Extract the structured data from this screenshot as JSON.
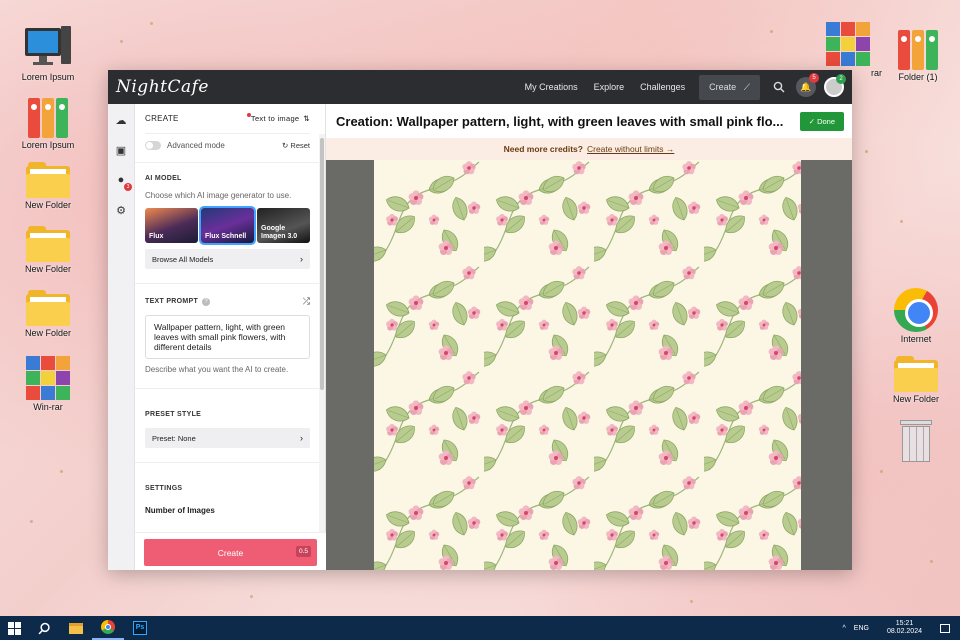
{
  "desktop": {
    "icons": [
      {
        "label": "Lorem Ipsum"
      },
      {
        "label": "Lorem Ipsum"
      },
      {
        "label": "New Folder"
      },
      {
        "label": "New Folder"
      },
      {
        "label": "New Folder"
      },
      {
        "label": "Win-rar"
      },
      {
        "label": "rar"
      },
      {
        "label": "Folder (1)"
      },
      {
        "label": "Internet"
      },
      {
        "label": "New Folder"
      }
    ]
  },
  "app": {
    "logo": "NightCafe",
    "nav": [
      "My Creations",
      "Explore",
      "Challenges"
    ],
    "create_label": "Create",
    "notifications_count": "5",
    "avatar_count": "2"
  },
  "panel": {
    "header": "CREATE",
    "mode_select": "Text to image",
    "advanced_label": "Advanced mode",
    "reset_label": "Reset",
    "ai_model": {
      "label": "AI MODEL",
      "desc": "Choose which AI image generator to use.",
      "models": [
        "Flux",
        "Flux Schnell",
        "Google Imagen 3.0"
      ],
      "browse_label": "Browse All Models"
    },
    "text_prompt": {
      "label": "TEXT PROMPT",
      "value": "Wallpaper pattern, light, with green leaves with small pink flowers, with different details",
      "hint": "Describe what you want the AI to create."
    },
    "preset_style": {
      "label": "PRESET STYLE",
      "value": "Preset: None"
    },
    "settings": {
      "label": "SETTINGS",
      "num_images_label": "Number of Images"
    },
    "create_button": "Create",
    "create_cost": "0.5"
  },
  "main": {
    "title": "Creation: Wallpaper pattern, light, with green leaves with small pink flo...",
    "done_label": "Done",
    "credits_bold": "Need more credits?",
    "credits_link": "Create without limits →"
  },
  "taskbar": {
    "lang": "ENG",
    "time": "15:21",
    "date": "08.02.2024"
  },
  "colors": {
    "accent_create": "#ee5d73",
    "done_green": "#22973a",
    "topbar": "#2b2d31",
    "taskbar": "#0e2a4a"
  }
}
